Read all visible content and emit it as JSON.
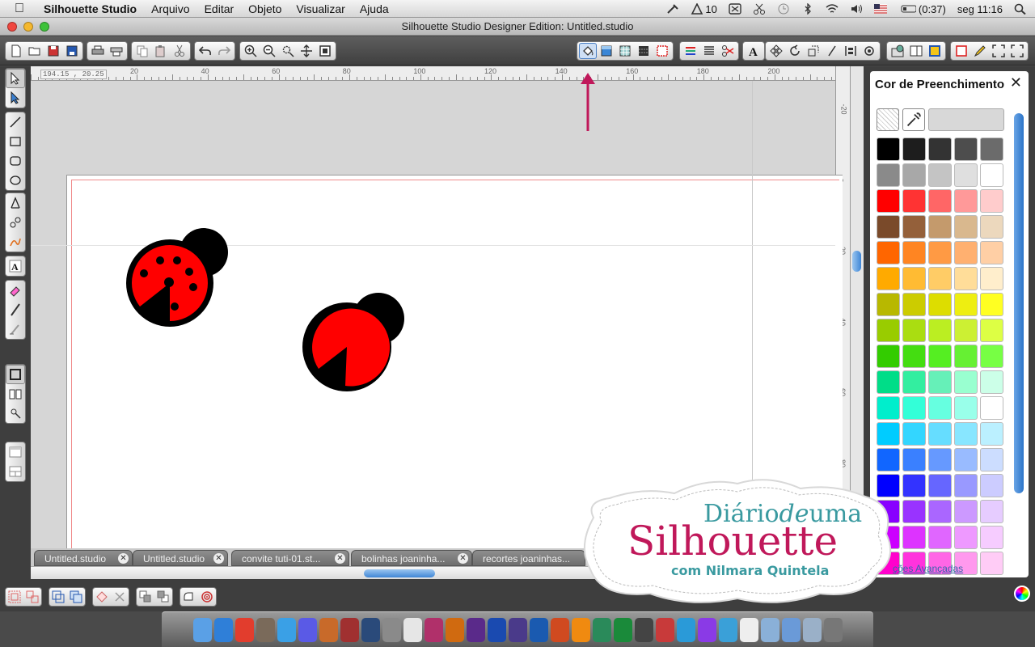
{
  "menubar": {
    "app_name": "Silhouette Studio",
    "items": [
      "Arquivo",
      "Editar",
      "Objeto",
      "Visualizar",
      "Ajuda"
    ],
    "status": {
      "badge": "10",
      "battery": "(0:37)",
      "clock": "seg 11:16"
    }
  },
  "window": {
    "title": "Silhouette Studio Designer Edition: Untitled.studio"
  },
  "canvas": {
    "coords": "194.15 , 20.25",
    "ruler_top": [
      "20",
      "40",
      "60",
      "80",
      "100",
      "120",
      "140",
      "160",
      "180",
      "200"
    ],
    "ruler_right": [
      "-20",
      "0",
      "20",
      "40",
      "60",
      "80"
    ]
  },
  "tabs": [
    {
      "label": "Untitled.studio"
    },
    {
      "label": "Untitled.studio"
    },
    {
      "label": "convite tuti-01.st..."
    },
    {
      "label": "bolinhas joaninha..."
    },
    {
      "label": "recortes joaninhas..."
    }
  ],
  "color_panel": {
    "title": "Cor de Preenchimento",
    "advanced_link": "ções Avançadas",
    "rows": [
      [
        "#000000",
        "#1d1d1d",
        "#333333",
        "#4d4d4d",
        "#6b6b6b"
      ],
      [
        "#8a8a8a",
        "#a8a8a8",
        "#c4c4c4",
        "#dfdfdf",
        "#ffffff"
      ],
      [
        "#ff0000",
        "#ff3333",
        "#ff6666",
        "#ff9999",
        "#ffcccc"
      ],
      [
        "#7a4a2a",
        "#94603a",
        "#c49a6c",
        "#d9b88e",
        "#ecd8bd"
      ],
      [
        "#ff6600",
        "#ff8522",
        "#ff9a44",
        "#ffb070",
        "#ffcfa5"
      ],
      [
        "#ffaa00",
        "#ffbb33",
        "#ffcc66",
        "#ffdd99",
        "#ffeecc"
      ],
      [
        "#b8b800",
        "#cccc00",
        "#dddd00",
        "#eeee11",
        "#ffff22"
      ],
      [
        "#99cc00",
        "#aadd11",
        "#bbee22",
        "#ccf033",
        "#ddff44"
      ],
      [
        "#33cc00",
        "#44dd11",
        "#55ee22",
        "#66f033",
        "#77ff44"
      ],
      [
        "#00dd88",
        "#33eea0",
        "#66f0b8",
        "#99ffd0",
        "#ccffe8"
      ],
      [
        "#00eecc",
        "#33ffd8",
        "#66ffe0",
        "#99ffea",
        "#ffffff"
      ],
      [
        "#00ccff",
        "#33d6ff",
        "#66ddff",
        "#88e6ff",
        "#bbf0ff"
      ],
      [
        "#1166ff",
        "#3a80ff",
        "#6699ff",
        "#99bbff",
        "#ccddff"
      ],
      [
        "#0000ff",
        "#3333ff",
        "#6666ff",
        "#9999ff",
        "#ccccff"
      ],
      [
        "#8800ff",
        "#9933ff",
        "#aa66ff",
        "#cc99ff",
        "#e6ccff"
      ],
      [
        "#cc00ff",
        "#dd33ff",
        "#e066ff",
        "#ee99ff",
        "#f6ccff"
      ],
      [
        "#ff00cc",
        "#ff33dd",
        "#ff66e6",
        "#ff99ee",
        "#ffccf6"
      ]
    ]
  },
  "watermark": {
    "line1": "Diário",
    "line1b": "de",
    "line1c": "uma",
    "line2": "Silhouette",
    "line3": "com Nilmara Quintela"
  },
  "colors": {
    "ladybug_red": "#ff0000",
    "ladybug_black": "#000000",
    "accent_blue": "#3f86d6",
    "watermark_pink": "#c0185a",
    "watermark_teal": "#3a9aa0",
    "annotation_arrow": "#c0185a"
  },
  "dock": [
    "finder",
    "app-store",
    "chrome",
    "photos",
    "safari",
    "itunes",
    "preview",
    "photo-booth",
    "time-machine",
    "system-prefs",
    "ical",
    "indesign",
    "illustrator",
    "premiere",
    "photoshop",
    "after-effects",
    "word",
    "powerpoint",
    "vlc",
    "camtasia",
    "excel",
    "dvd",
    "airmail",
    "skype",
    "unicode",
    "silhouette",
    "textedit",
    "folder",
    "applications",
    "documents",
    "trash"
  ]
}
